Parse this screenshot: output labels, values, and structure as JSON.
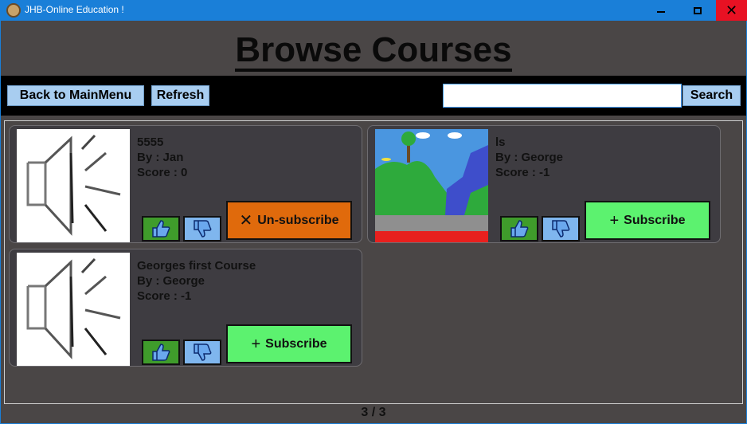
{
  "window": {
    "title": "JHB-Online Education !",
    "controls": {
      "minimize": "minimize",
      "maximize": "maximize",
      "close": "close"
    }
  },
  "page": {
    "title": "Browse Courses"
  },
  "toolbar": {
    "back_label": "Back to MainMenu",
    "refresh_label": "Refresh",
    "search_value": "",
    "search_label": "Search"
  },
  "courses": [
    {
      "title": "5555",
      "by": "By : Jan",
      "score": "Score : 0",
      "action": "Un-subscribe",
      "action_icon": "close-icon",
      "action_color": "#e06a0c",
      "thumbnail": "speaker-icon"
    },
    {
      "title": "ls",
      "by": "By : George",
      "score": "Score : -1",
      "action": "Subscribe",
      "action_icon": "plus-icon",
      "action_color": "#5cf26f",
      "thumbnail": "landscape-drawing"
    },
    {
      "title": "Georges first Course",
      "by": "By : George",
      "score": "Score : -1",
      "action": "Subscribe",
      "action_icon": "plus-icon",
      "action_color": "#5cf26f",
      "thumbnail": "speaker-icon"
    }
  ],
  "pager": {
    "text": "3 / 3"
  },
  "colors": {
    "titlebar": "#1a7fd8",
    "background": "#4a4646",
    "toolbar": "#000000",
    "button": "#a8cdf0",
    "card": "#3e3c41",
    "thumbs_up": "#3f9c2b",
    "thumbs_down": "#7fb6ee"
  }
}
